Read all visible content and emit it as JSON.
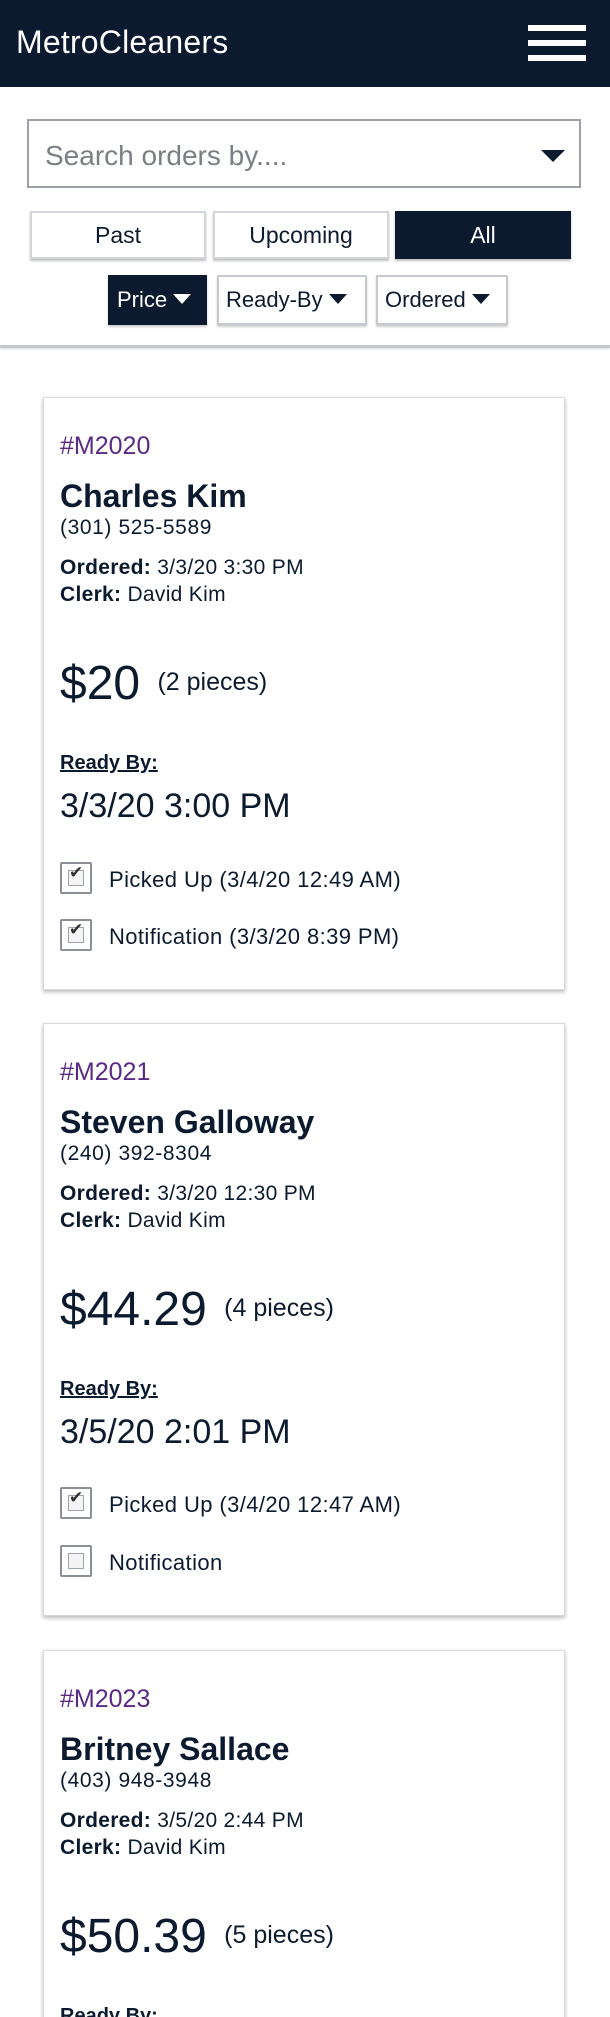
{
  "header": {
    "brand": "MetroCleaners",
    "menu_icon": "hamburger-menu-icon"
  },
  "search": {
    "placeholder": "Search orders by....",
    "dropdown_icon": "caret-down-icon"
  },
  "filters": {
    "tabs": [
      "Past",
      "Upcoming",
      "All"
    ],
    "active_tab": "All"
  },
  "sort": {
    "buttons": [
      "Price",
      "Ready-By",
      "Ordered"
    ],
    "active": "Price"
  },
  "colors": {
    "navy": "#0b1a2e",
    "order_number": "#5a2a86"
  },
  "orders": [
    {
      "number": "#M2020",
      "customer": "Charles Kim",
      "phone": "(301) 525-5589",
      "ordered_label": "Ordered:",
      "ordered": "3/3/20 3:30 PM",
      "clerk_label": "Clerk:",
      "clerk": "David Kim",
      "price": "$20",
      "pieces": "(2 pieces)",
      "ready_by_label": "Ready By:",
      "ready_by": "3/3/20 3:00 PM",
      "picked_up_checked": true,
      "picked_up_label": "Picked Up (3/4/20 12:49 AM)",
      "notification_checked": true,
      "notification_label": "Notification (3/3/20 8:39 PM)"
    },
    {
      "number": "#M2021",
      "customer": "Steven Galloway",
      "phone": "(240) 392-8304",
      "ordered_label": "Ordered:",
      "ordered": "3/3/20 12:30 PM",
      "clerk_label": "Clerk:",
      "clerk": "David Kim",
      "price": "$44.29",
      "pieces": "(4 pieces)",
      "ready_by_label": "Ready By:",
      "ready_by": "3/5/20 2:01 PM",
      "picked_up_checked": true,
      "picked_up_label": "Picked Up (3/4/20 12:47 AM)",
      "notification_checked": false,
      "notification_label": "Notification"
    },
    {
      "number": "#M2023",
      "customer": "Britney Sallace",
      "phone": "(403) 948-3948",
      "ordered_label": "Ordered:",
      "ordered": "3/5/20 2:44 PM",
      "clerk_label": "Clerk:",
      "clerk": "David Kim",
      "price": "$50.39",
      "pieces": "(5 pieces)",
      "ready_by_label": "Ready By:"
    }
  ]
}
